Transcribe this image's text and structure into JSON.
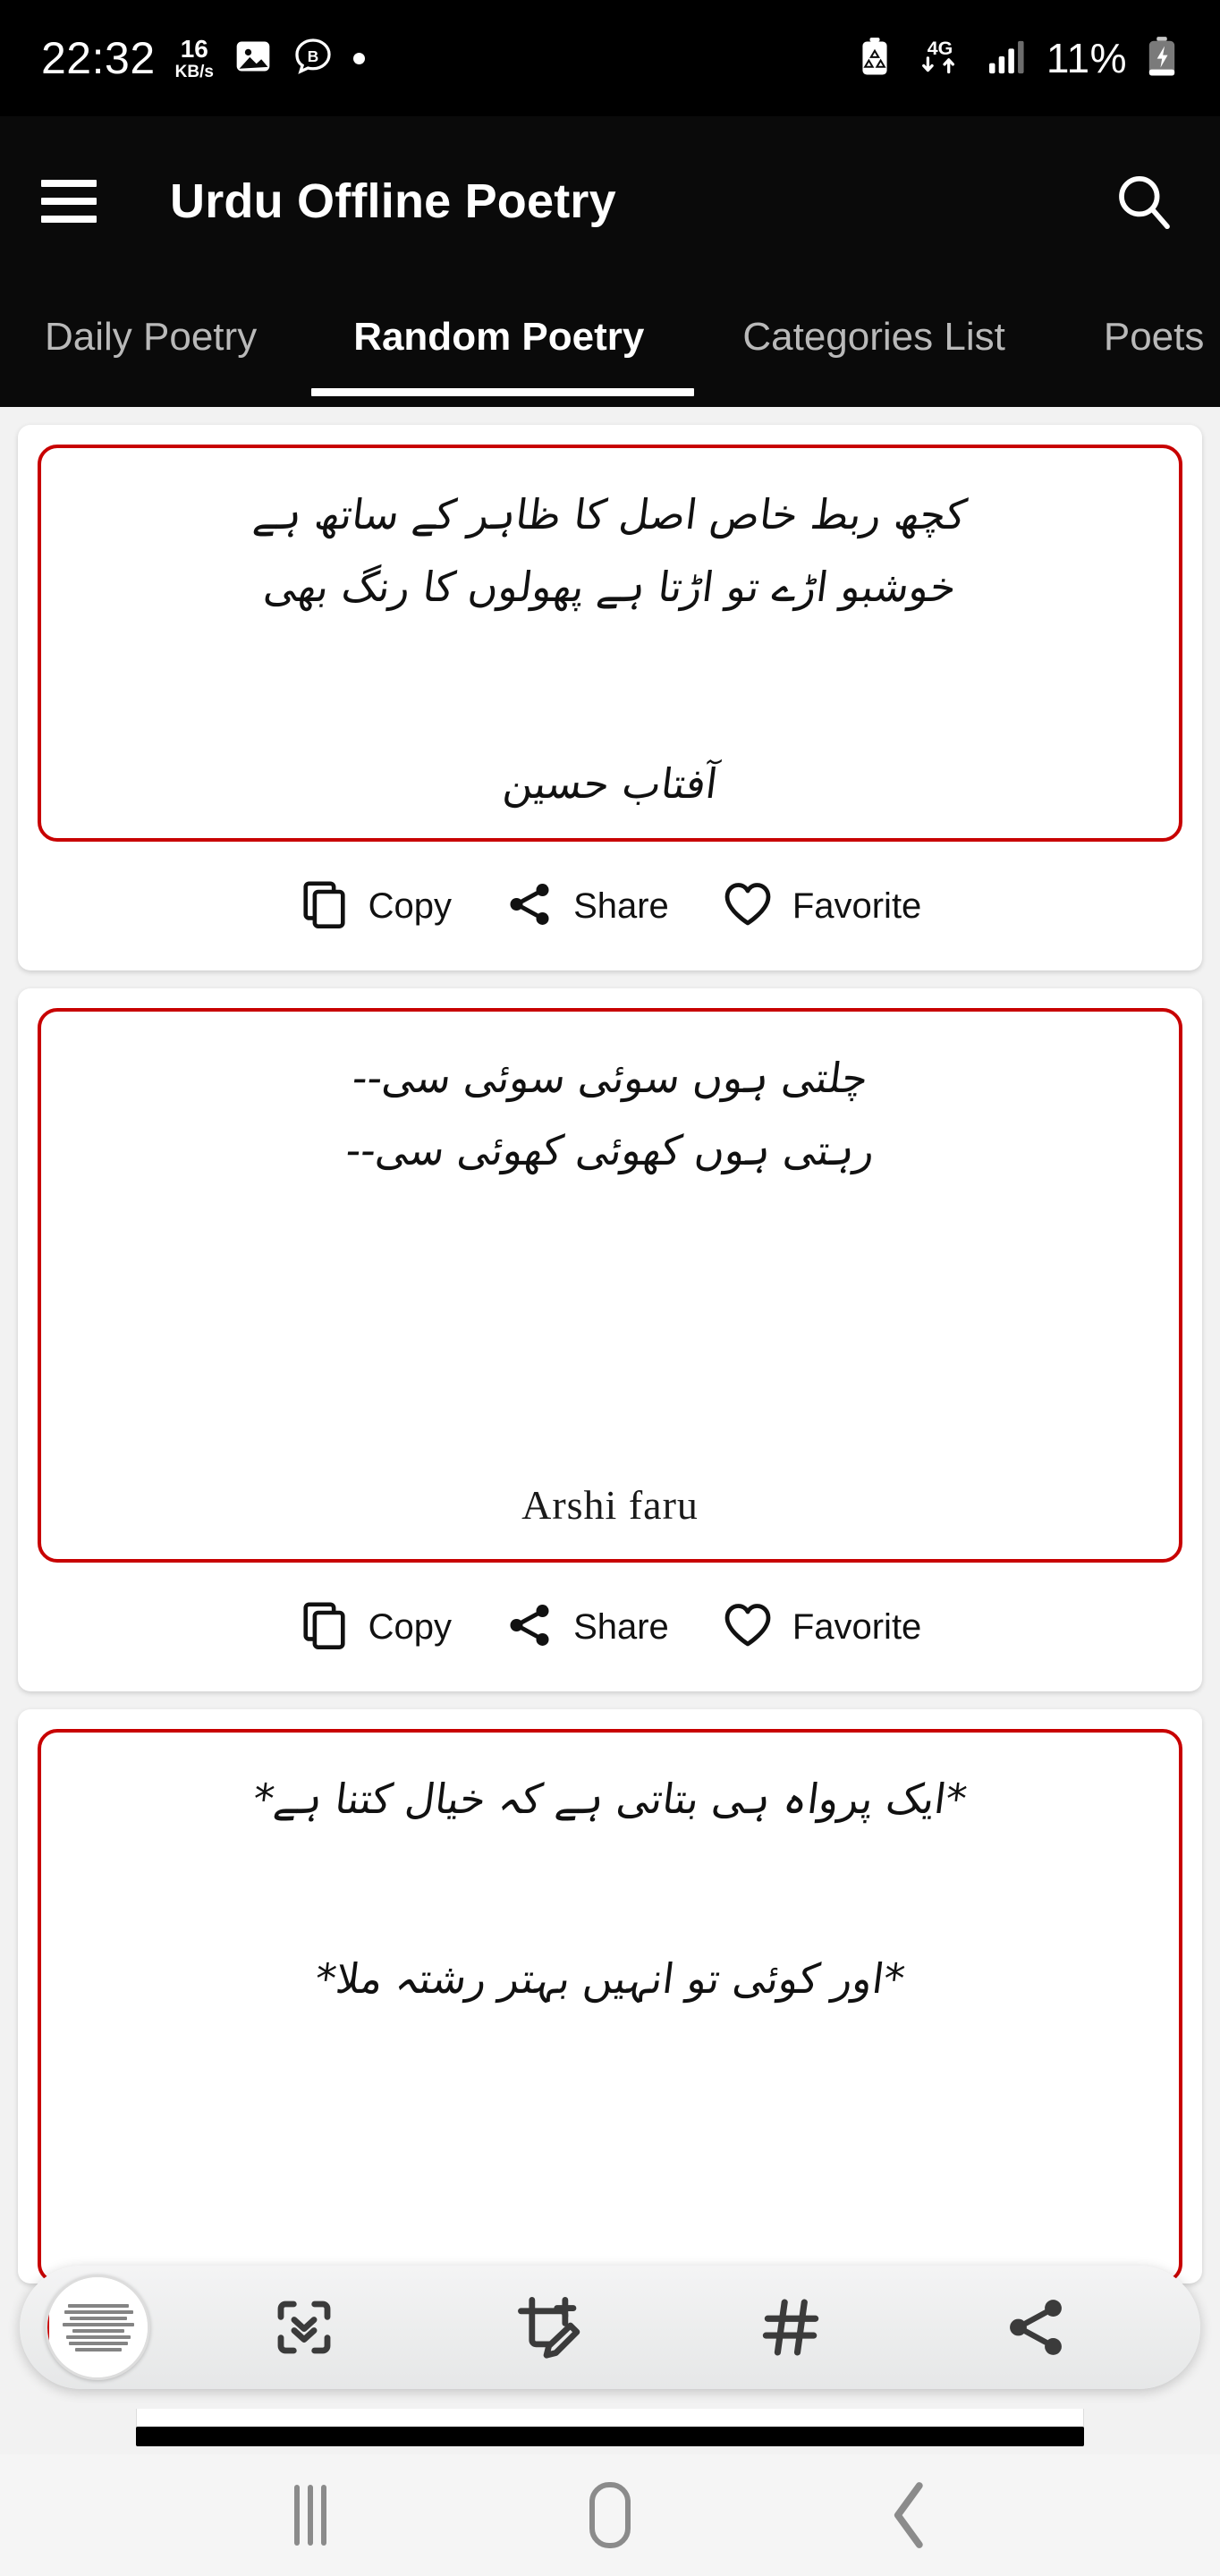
{
  "status_bar": {
    "clock": "22:32",
    "network_speed_value": "16",
    "network_speed_unit": "KB/s",
    "icons_left": [
      "photo-icon",
      "bixby-b-icon",
      "dot-indicator-icon"
    ],
    "battery_saver_icon": "battery-saver-icon",
    "network_type": "4G",
    "signal_icon": "signal-bars-icon",
    "battery_percent": "11%",
    "battery_icon": "battery-charging-icon"
  },
  "app_bar": {
    "menu_icon": "hamburger-menu-icon",
    "title": "Urdu Offline Poetry",
    "search_icon": "search-icon",
    "background": "#0a0a0a"
  },
  "tabs": {
    "active_index": 1,
    "items": [
      {
        "label": "Daily Poetry"
      },
      {
        "label": "Random Poetry"
      },
      {
        "label": "Categories List"
      },
      {
        "label": "Poets"
      }
    ],
    "indicator_color": "#ffffff",
    "inactive_color": "#b9b9b9"
  },
  "actions": {
    "copy_label": "Copy",
    "share_label": "Share",
    "favorite_label": "Favorite",
    "copy_icon": "copy-icon",
    "share_icon": "share-icon",
    "favorite_icon": "heart-outline-icon"
  },
  "card_style": {
    "border_color": "#c80000",
    "card_background": "#ffffff",
    "page_background": "#f2f2f2"
  },
  "poems": [
    {
      "line1": "کچھ ربط خاص اصل کا ظاہر کے ساتھ ہے",
      "line2": "خوشبو اڑے تو اڑتا ہے پھولوں کا رنگ بھی",
      "author": "آفتاب حسین",
      "author_script": "urdu"
    },
    {
      "line1": "چلتی ہوں سوئی سوئی سی--",
      "line2": "رہتی ہوں کھوئی کھوئی سی--",
      "author": "Arshi faru",
      "author_script": "latin"
    },
    {
      "line1": "*ایک پرواہ ہی بتاتی ہے کہ خیال کتنا ہے*",
      "line2": "*اور کوئی تو انہیں بہتر رشتہ ملا*",
      "author": "",
      "author_script": "urdu"
    }
  ],
  "screenshot_toolbar": {
    "thumbnail_name": "screenshot-thumbnail",
    "buttons": [
      {
        "icon": "scroll-capture-icon"
      },
      {
        "icon": "crop-edit-icon"
      },
      {
        "icon": "hashtag-tag-icon"
      },
      {
        "icon": "share-icon"
      }
    ]
  },
  "nav_bar": {
    "recents_icon": "recents-icon",
    "home_icon": "home-icon",
    "back_icon": "back-icon",
    "background": "#f5f5f5"
  }
}
